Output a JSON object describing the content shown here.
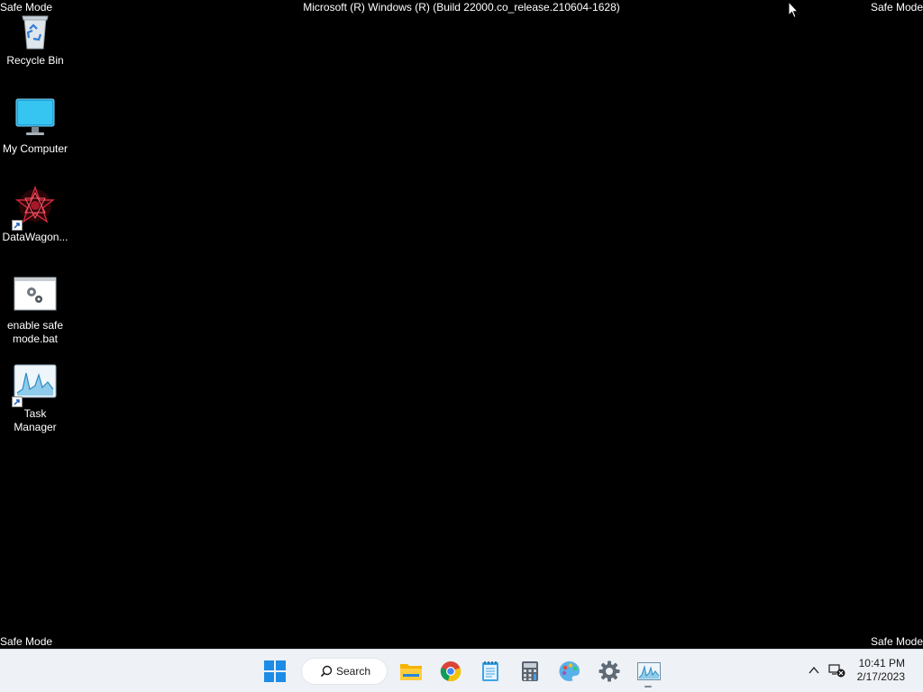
{
  "watermark": {
    "top_left": "Safe Mode",
    "top_right": "Safe Mode",
    "bottom_left": "Safe Mode",
    "bottom_right": "Safe Mode",
    "build_string": "Microsoft (R) Windows (R) (Build 22000.co_release.210604-1628)"
  },
  "desktop": {
    "icons": [
      {
        "label": "Recycle Bin",
        "icon": "recycle-bin-icon"
      },
      {
        "label": "My Computer",
        "icon": "monitor-icon"
      },
      {
        "label": "DataWagon...",
        "icon": "datawagon-icon",
        "shortcut": true
      },
      {
        "label": "enable safe mode.bat",
        "icon": "batch-file-icon"
      },
      {
        "label": "Task Manager",
        "icon": "task-manager-icon",
        "shortcut": true
      }
    ]
  },
  "taskbar": {
    "search_label": "Search",
    "pinned": [
      "start-icon",
      "file-explorer-icon",
      "chrome-icon",
      "notepad-icon",
      "calculator-icon",
      "paint-icon",
      "settings-icon",
      "task-manager-icon"
    ],
    "active_app": "task-manager-icon"
  },
  "tray": {
    "time": "10:41 PM",
    "date": "2/17/2023"
  }
}
